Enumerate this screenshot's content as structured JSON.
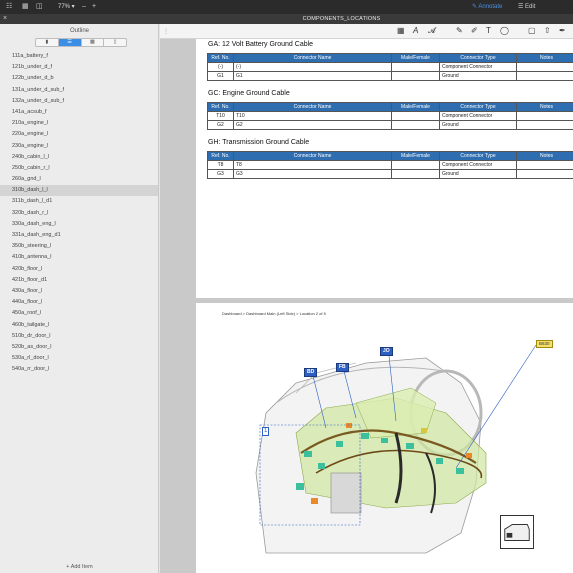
{
  "toolbar": {
    "zoom": "77%",
    "annotate_label": "Annotate",
    "edit_label": "Edit"
  },
  "window": {
    "title": "COMPONENTS_LOCATIONS"
  },
  "sidebar": {
    "title": "Outline",
    "add_item_label": "+ Add Item",
    "selected_index": 12,
    "items": [
      "111a_battery_f",
      "121b_under_d_f",
      "122b_under_d_b",
      "131a_under_d_sub_f",
      "132a_under_d_sub_f",
      "141a_acsub_f",
      "210a_engine_l",
      "220a_engine_l",
      "230a_engine_l",
      "240b_cabin_l_l",
      "250b_cabin_r_l",
      "260a_gnd_l",
      "310b_dash_l_l",
      "311b_dash_l_d1",
      "320b_dash_r_l",
      "330a_dash_eng_l",
      "331a_dash_eng_d1",
      "350b_steering_l",
      "410b_antenna_l",
      "420b_floor_l",
      "421b_floor_d1",
      "430a_floor_l",
      "440a_floor_l",
      "450a_roof_l",
      "460b_tailgate_l",
      "510b_dr_door_l",
      "520b_as_door_l",
      "530a_rl_door_l",
      "540a_rr_door_l"
    ]
  },
  "document": {
    "sections": [
      {
        "title": "GA: 12 Volt Battery Ground Cable",
        "headers": [
          "Ref. No.",
          "Connector Name",
          "Male/Female",
          "Connector Type",
          "Notes"
        ],
        "rows": [
          [
            "(-)",
            "(-)",
            "",
            "Component Connector",
            ""
          ],
          [
            "G1",
            "G1",
            "",
            "Ground",
            ""
          ]
        ]
      },
      {
        "title": "GC: Engine Ground Cable",
        "headers": [
          "Ref. No.",
          "Connector Name",
          "Male/Female",
          "Connector Type",
          "Notes"
        ],
        "rows": [
          [
            "T10",
            "T10",
            "",
            "Component Connector",
            ""
          ],
          [
            "G2",
            "G2",
            "",
            "Ground",
            ""
          ]
        ]
      },
      {
        "title": "GH: Transmission Ground Cable",
        "headers": [
          "Ref. No.",
          "Connector Name",
          "Male/Female",
          "Connector Type",
          "Notes"
        ],
        "rows": [
          [
            "T8",
            "T8",
            "",
            "Component Connector",
            ""
          ],
          [
            "G3",
            "G3",
            "",
            "Ground",
            ""
          ]
        ]
      }
    ],
    "page2": {
      "breadcrumb": "Dashboard > Dashboard Main (Left Side) > Location  2 of 5",
      "callouts": [
        "BD",
        "FB",
        "JO"
      ],
      "yellow_callout": "B630",
      "zone_label": "1"
    }
  }
}
